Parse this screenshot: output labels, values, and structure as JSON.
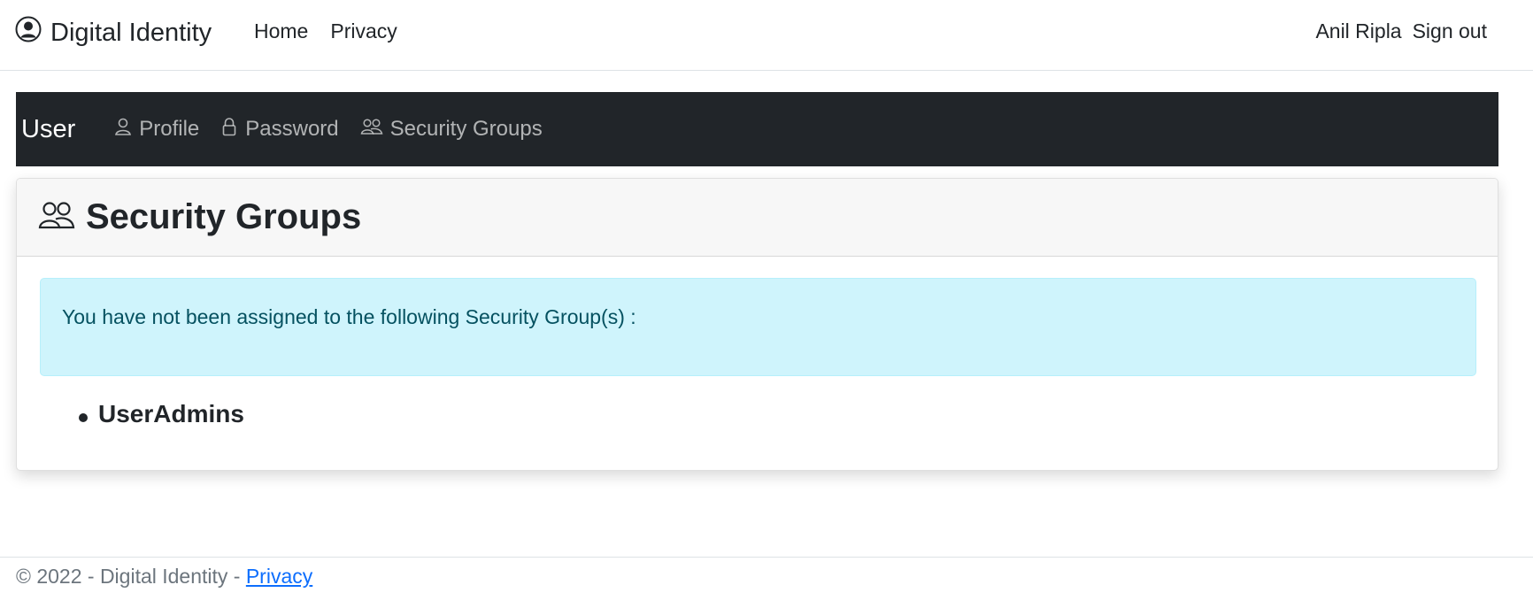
{
  "header": {
    "brand": "Digital Identity",
    "brand_icon": "person-circle-icon",
    "nav": [
      "Home",
      "Privacy"
    ],
    "user_name": "Anil Ripla",
    "sign_out": "Sign out"
  },
  "subnav": {
    "title": "User",
    "items": [
      {
        "label": "Profile",
        "icon": "person-icon"
      },
      {
        "label": "Password",
        "icon": "lock-icon"
      },
      {
        "label": "Security Groups",
        "icon": "people-icon"
      }
    ]
  },
  "card": {
    "title": "Security Groups",
    "title_icon": "people-icon",
    "alert_text": "You have not been assigned to the following Security Group(s) :",
    "groups": [
      "UserAdmins"
    ]
  },
  "footer": {
    "text": "© 2022 - Digital Identity - ",
    "link": "Privacy"
  },
  "colors": {
    "subnav_bg": "#212529",
    "alert_bg": "#cff4fc",
    "link": "#0d6efd"
  }
}
